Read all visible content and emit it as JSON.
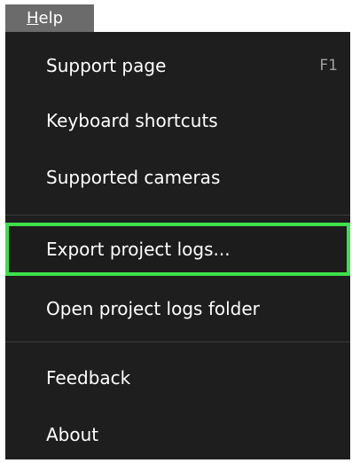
{
  "menubar": {
    "title_mnemonic": "H",
    "title_rest": "elp"
  },
  "menu": {
    "items": [
      {
        "label": "Support page",
        "shortcut": "F1"
      },
      {
        "label": "Keyboard shortcuts",
        "shortcut": ""
      },
      {
        "label": "Supported cameras",
        "shortcut": ""
      },
      {
        "label": "Export project logs...",
        "shortcut": ""
      },
      {
        "label": "Open project logs folder",
        "shortcut": ""
      },
      {
        "label": "Feedback",
        "shortcut": ""
      },
      {
        "label": "About",
        "shortcut": ""
      }
    ]
  },
  "colors": {
    "menu_bg": "#1e1e1e",
    "title_bg": "#6b6b6b",
    "highlight_border": "#3de04a",
    "separator": "#3c3c3c"
  }
}
